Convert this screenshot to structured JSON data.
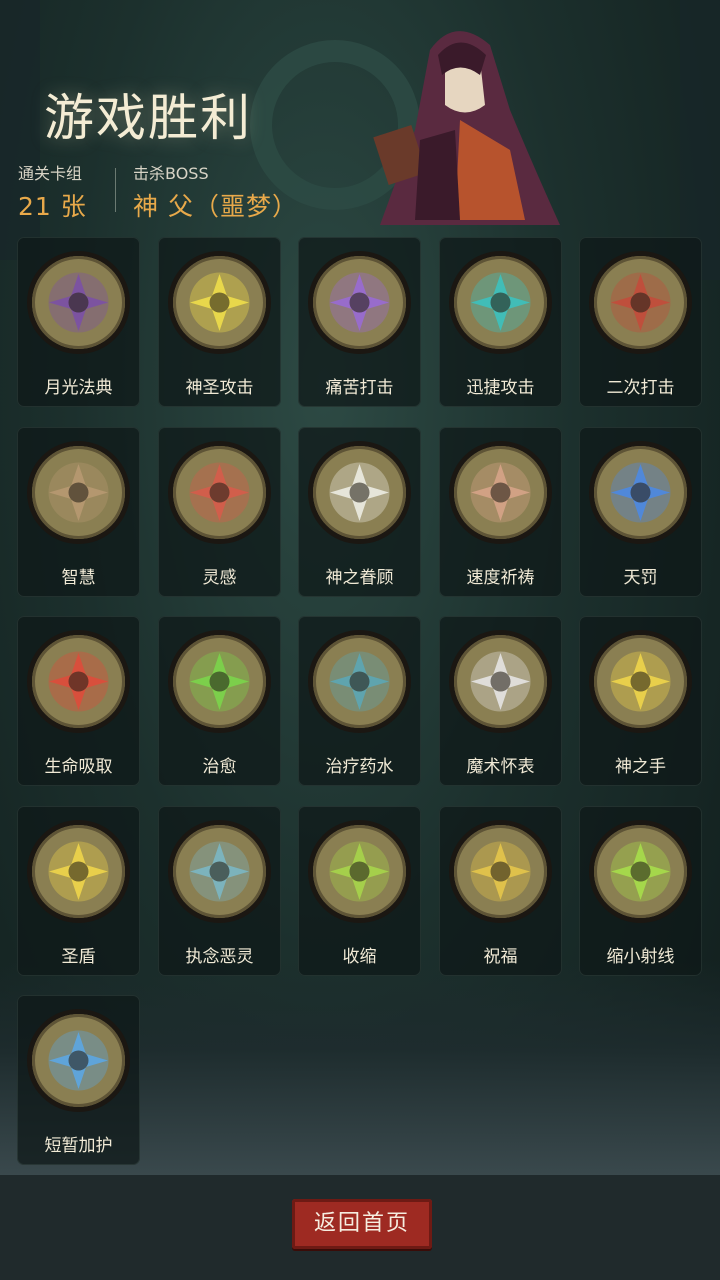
{
  "header": {
    "title": "游戏胜利",
    "cards_label": "通关卡组",
    "cards_value": "21 张",
    "boss_label": "击杀BOSS",
    "boss_value": "神 父（噩梦）"
  },
  "cards": [
    {
      "label": "月光法典",
      "icon": "moonlight-tome-icon",
      "color": "#7a4fa8"
    },
    {
      "label": "神圣攻击",
      "icon": "holy-strike-icon",
      "color": "#f2e04a"
    },
    {
      "label": "痛苦打击",
      "icon": "pain-strike-icon",
      "color": "#9a6ad8"
    },
    {
      "label": "迅捷攻击",
      "icon": "swift-attack-icon",
      "color": "#3ac4c2"
    },
    {
      "label": "二次打击",
      "icon": "double-strike-icon",
      "color": "#c44a3a"
    },
    {
      "label": "智慧",
      "icon": "wisdom-icon",
      "color": "#b89a72"
    },
    {
      "label": "灵感",
      "icon": "inspiration-icon",
      "color": "#d85a4a"
    },
    {
      "label": "神之眷顾",
      "icon": "divine-favor-icon",
      "color": "#f0f0e8"
    },
    {
      "label": "速度祈祷",
      "icon": "speed-prayer-icon",
      "color": "#d8a58a"
    },
    {
      "label": "天罚",
      "icon": "heavenly-punishment-icon",
      "color": "#4a8ae8"
    },
    {
      "label": "生命吸取",
      "icon": "life-drain-icon",
      "color": "#e04a3a"
    },
    {
      "label": "治愈",
      "icon": "heal-icon",
      "color": "#7ad84a"
    },
    {
      "label": "治疗药水",
      "icon": "healing-potion-icon",
      "color": "#5aa8b8"
    },
    {
      "label": "魔术怀表",
      "icon": "magic-pocket-watch-icon",
      "color": "#e8e8e8"
    },
    {
      "label": "神之手",
      "icon": "hand-of-god-icon",
      "color": "#f2d84a"
    },
    {
      "label": "圣盾",
      "icon": "holy-shield-icon",
      "color": "#f2d84a"
    },
    {
      "label": "执念恶灵",
      "icon": "obsessed-spirit-icon",
      "color": "#7ab8c8"
    },
    {
      "label": "收缩",
      "icon": "shrink-icon",
      "color": "#a8d84a"
    },
    {
      "label": "祝福",
      "icon": "blessing-icon",
      "color": "#e8c84a"
    },
    {
      "label": "缩小射线",
      "icon": "shrink-ray-icon",
      "color": "#a8e04a"
    },
    {
      "label": "短暂加护",
      "icon": "brief-protection-icon",
      "color": "#5aa8e8"
    }
  ],
  "footer": {
    "back_label": "返回首页"
  }
}
